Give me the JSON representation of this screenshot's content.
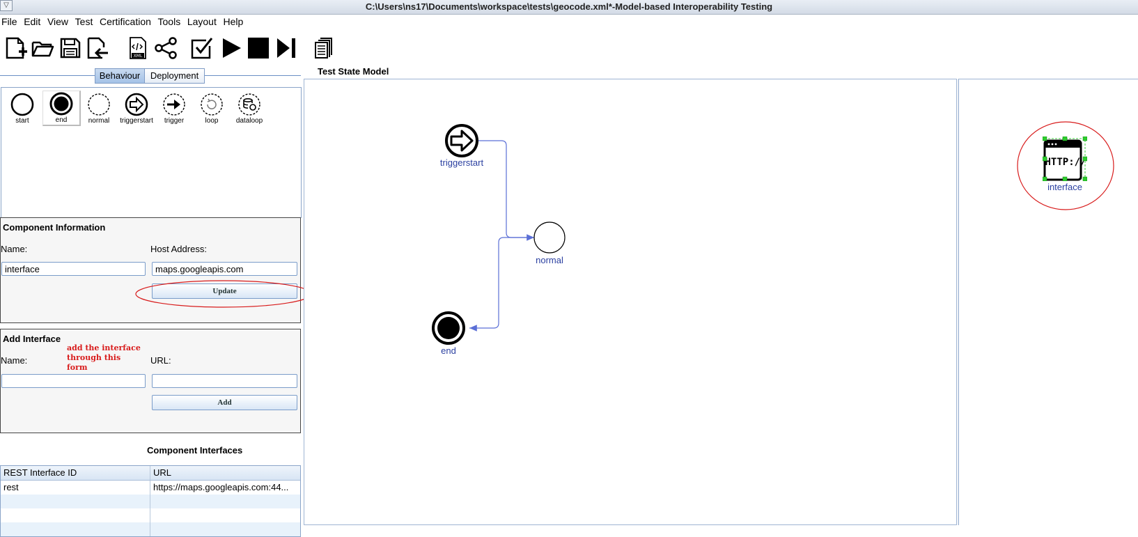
{
  "window": {
    "title": "C:\\Users\\ns17\\Documents\\workspace\\tests\\geocode.xml*-Model-based Interoperability Testing",
    "sysmenu_icon": "chevron-down-icon"
  },
  "menu": [
    "File",
    "Edit",
    "View",
    "Test",
    "Certification",
    "Tools",
    "Layout",
    "Help"
  ],
  "toolbar": {
    "icons": [
      "new-file-icon",
      "open-folder-icon",
      "save-icon",
      "import-icon",
      "xml-icon",
      "share-graph-icon",
      "check-icon",
      "play-icon",
      "stop-icon",
      "step-forward-icon",
      "copy-pages-icon"
    ]
  },
  "tabs": {
    "behaviour": "Behaviour",
    "deployment": "Deployment",
    "active": "Behaviour"
  },
  "palette": {
    "items": [
      "start",
      "end",
      "normal",
      "triggerstart",
      "trigger",
      "loop",
      "dataloop"
    ],
    "selected": "end"
  },
  "component_info": {
    "title": "Component Information",
    "name_label": "Name:",
    "name_value": "interface",
    "host_label": "Host Address:",
    "host_value": "maps.googleapis.com",
    "update_button": "Update"
  },
  "add_interface": {
    "title": "Add Interface",
    "annotation": "add the interface through this form",
    "name_label": "Name:",
    "name_value": "",
    "url_label": "URL:",
    "url_value": "",
    "add_button": "Add"
  },
  "component_interfaces": {
    "title": "Component Interfaces",
    "columns": [
      "REST Interface ID",
      "URL"
    ],
    "rows": [
      [
        "rest",
        "https://maps.googleapis.com:44..."
      ]
    ]
  },
  "canvas": {
    "title": "Test State Model",
    "nodes": {
      "triggerstart": "triggerstart",
      "normal": "normal",
      "end": "end"
    }
  },
  "deployment_view": {
    "node_label": "interface",
    "node_icon_text": "HTTP://"
  },
  "colors": {
    "accent": "#7a9cc9",
    "link": "#5b6fd6",
    "annotation": "#d81b1b",
    "node_label": "#2a3fa0"
  }
}
